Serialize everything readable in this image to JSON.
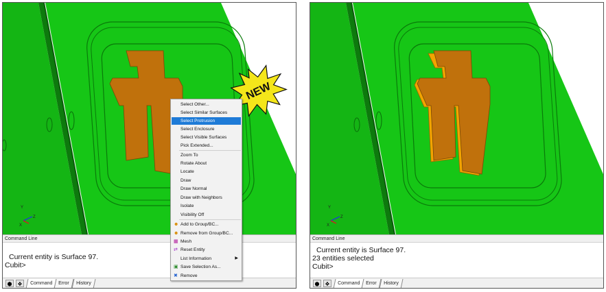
{
  "colors": {
    "model_green": "#16c616",
    "model_dark_green": "#0a6d0a",
    "protrusion": "#c0710c",
    "protrusion_highlight": "#f2a400",
    "menu_highlight": "#1e7bd7",
    "new_burst": "#f4e61a"
  },
  "left": {
    "command_line_header": "Command Line",
    "lines": [
      "Current entity is Surface 97.",
      "Cubit>"
    ],
    "tabs": [
      "Command",
      "Error",
      "History"
    ],
    "axis_labels": {
      "y": "Y",
      "z": "Z",
      "x": "X"
    }
  },
  "right": {
    "command_line_header": "Command Line",
    "lines": [
      "Current entity is Surface 97.",
      "23 entities selected",
      "Cubit>"
    ],
    "tabs": [
      "Command",
      "Error",
      "History"
    ],
    "axis_labels": {
      "y": "Y",
      "z": "Z",
      "x": "X"
    }
  },
  "context_menu": {
    "items": [
      {
        "label": "Select Other...",
        "icon": ""
      },
      {
        "label": "Select Similar Surfaces",
        "icon": ""
      },
      {
        "label": "Select Protrusion",
        "icon": "",
        "highlighted": true
      },
      {
        "label": "Select Enclosure",
        "icon": ""
      },
      {
        "label": "Select Visible Surfaces",
        "icon": ""
      },
      {
        "label": "Pick Extended...",
        "icon": ""
      },
      {
        "label": "Zoom To",
        "icon": ""
      },
      {
        "label": "Rotate About",
        "icon": ""
      },
      {
        "label": "Locate",
        "icon": ""
      },
      {
        "label": "Draw",
        "icon": ""
      },
      {
        "label": "Draw Normal",
        "icon": ""
      },
      {
        "label": "Draw with Neighbors",
        "icon": ""
      },
      {
        "label": "Isolate",
        "icon": ""
      },
      {
        "label": "Visibility Off",
        "icon": ""
      },
      {
        "label": "Add to Group/BC...",
        "icon": "group-add-icon"
      },
      {
        "label": "Remove from Group/BC...",
        "icon": "group-remove-icon"
      },
      {
        "label": "Mesh",
        "icon": "mesh-icon"
      },
      {
        "label": "Reset Entity",
        "icon": "reset-icon"
      },
      {
        "label": "List Information",
        "icon": "",
        "submenu": true
      },
      {
        "label": "Save Selection As...",
        "icon": "save-icon"
      },
      {
        "label": "Remove",
        "icon": "remove-icon"
      }
    ]
  },
  "new_badge": "NEW"
}
